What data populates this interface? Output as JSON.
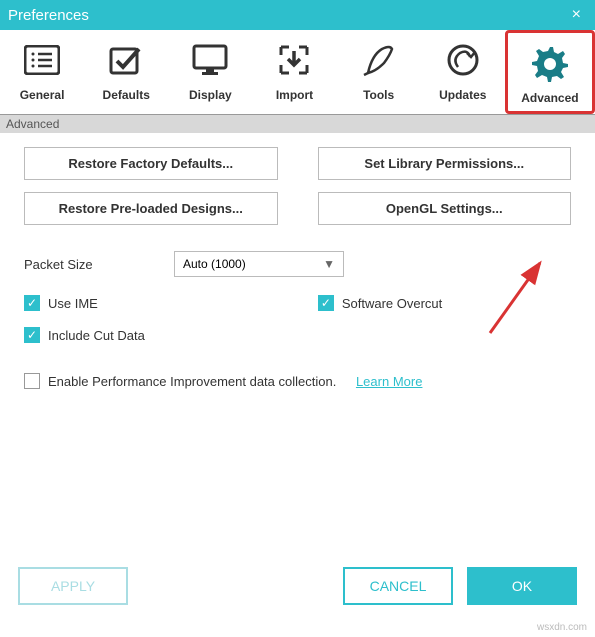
{
  "window": {
    "title": "Preferences"
  },
  "tabs": {
    "general": "General",
    "defaults": "Defaults",
    "display": "Display",
    "import": "Import",
    "tools": "Tools",
    "updates": "Updates",
    "advanced": "Advanced"
  },
  "section_header": "Advanced",
  "buttons": {
    "restore_factory": "Restore Factory Defaults...",
    "set_library": "Set Library Permissions...",
    "restore_preloaded": "Restore Pre-loaded Designs...",
    "opengl": "OpenGL Settings..."
  },
  "form": {
    "packet_size_label": "Packet Size",
    "packet_size_value": "Auto (1000)"
  },
  "checkboxes": {
    "use_ime": "Use IME",
    "software_overcut": "Software Overcut",
    "include_cut_data": "Include Cut Data",
    "enable_perf": "Enable Performance Improvement data collection.",
    "learn_more": "Learn More"
  },
  "dialog": {
    "apply": "APPLY",
    "cancel": "CANCEL",
    "ok": "OK"
  },
  "watermark": "wsxdn.com"
}
